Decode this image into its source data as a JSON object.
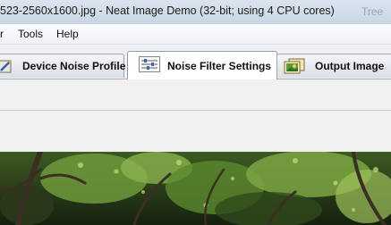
{
  "window": {
    "title": "523-2560x1600.jpg - Neat Image Demo (32-bit; using 4 CPU cores)",
    "background_ghost_text": "Tree"
  },
  "menu": {
    "items": [
      {
        "label": "r"
      },
      {
        "label": "Tools"
      },
      {
        "label": "Help"
      }
    ]
  },
  "tabs": [
    {
      "label": "Device Noise Profile",
      "icon": "device-profile-icon",
      "active": false
    },
    {
      "label": "Noise Filter Settings",
      "icon": "sliders-icon",
      "active": true
    },
    {
      "label": "Output Image",
      "icon": "photos-icon",
      "active": false
    }
  ],
  "colors": {
    "accent_tab_border": "#8f99a5",
    "image_foliage": "#4f7a2a"
  }
}
